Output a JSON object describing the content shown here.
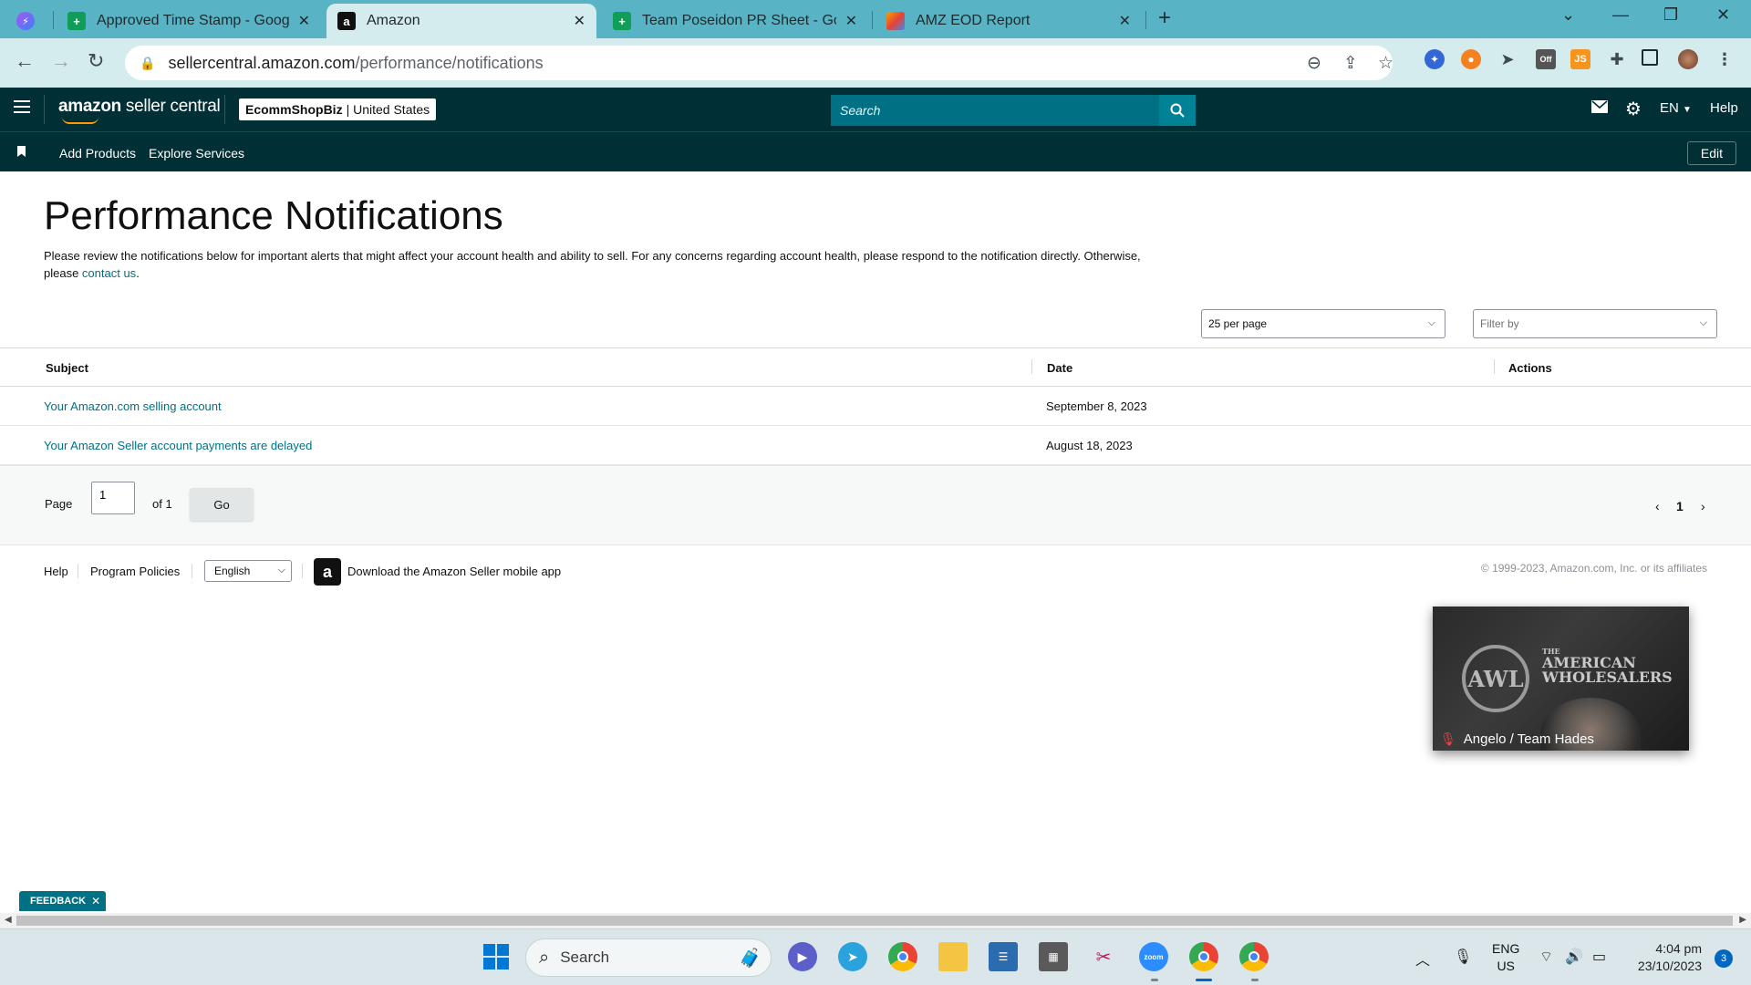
{
  "browser": {
    "tabs": [
      {
        "title": "Approved Time Stamp - Google",
        "fav_color": "#0f9d58",
        "icon": "sheets-icon",
        "active": false
      },
      {
        "title": "Amazon",
        "fav_color": "#111111",
        "icon": "amazon-icon",
        "active": true
      },
      {
        "title": "Team Poseidon PR Sheet - Goog",
        "fav_color": "#0f9d58",
        "icon": "sheets-icon",
        "active": false
      },
      {
        "title": "AMZ EOD Report",
        "fav_color": "#f2a600",
        "icon": "report-icon",
        "active": false
      }
    ],
    "close_glyph": "✕",
    "new_tab_glyph": "+",
    "url_host": "sellercentral.amazon.com",
    "url_path": "/performance/notifications",
    "extension_badge": "Off"
  },
  "header": {
    "logo_bold": "amazon",
    "logo_rest": " seller central",
    "account_name": "EcommShopBiz",
    "account_region": "| United States",
    "search_placeholder": "Search",
    "language": "EN",
    "help": "Help"
  },
  "subnav": {
    "links": [
      "Add Products",
      "Explore Services"
    ],
    "edit": "Edit"
  },
  "main": {
    "title": "Performance Notifications",
    "intro_text": "Please review the notifications below for important alerts that might affect your account health and ability to sell. For any concerns regarding account health, please respond to the notification directly. Otherwise, please ",
    "intro_link": "contact us",
    "intro_end": ".",
    "per_page": "25 per page",
    "filter_placeholder": "Filter by",
    "columns": {
      "subject": "Subject",
      "date": "Date",
      "actions": "Actions"
    },
    "rows": [
      {
        "subject": "Your Amazon.com selling account",
        "date": "September 8, 2023"
      },
      {
        "subject": "Your Amazon Seller account payments are delayed",
        "date": "August 18, 2023"
      }
    ],
    "pager": {
      "label": "Page",
      "current": "1",
      "of": "of 1",
      "go": "Go",
      "page_num": "1"
    }
  },
  "footer": {
    "help": "Help",
    "policies": "Program Policies",
    "language": "English",
    "app_text": "Download the Amazon Seller mobile app",
    "copyright": "© 1999-2023, Amazon.com, Inc. or its affiliates"
  },
  "video": {
    "emblem": "AWL",
    "brand_small": "THE",
    "brand_line1": "AMERICAN",
    "brand_line2": "WHOLESALERS",
    "participant": "Angelo / Team Hades"
  },
  "feedback": "FEEDBACK",
  "taskbar": {
    "search": "Search",
    "lang_line1": "ENG",
    "lang_line2": "US",
    "time": "4:04 pm",
    "date": "23/10/2023",
    "notifications": "3"
  },
  "colors": {
    "header_bg": "#002f36",
    "link": "#007185",
    "search_bg": "#007185",
    "tab_strip": "#58b3c4"
  }
}
